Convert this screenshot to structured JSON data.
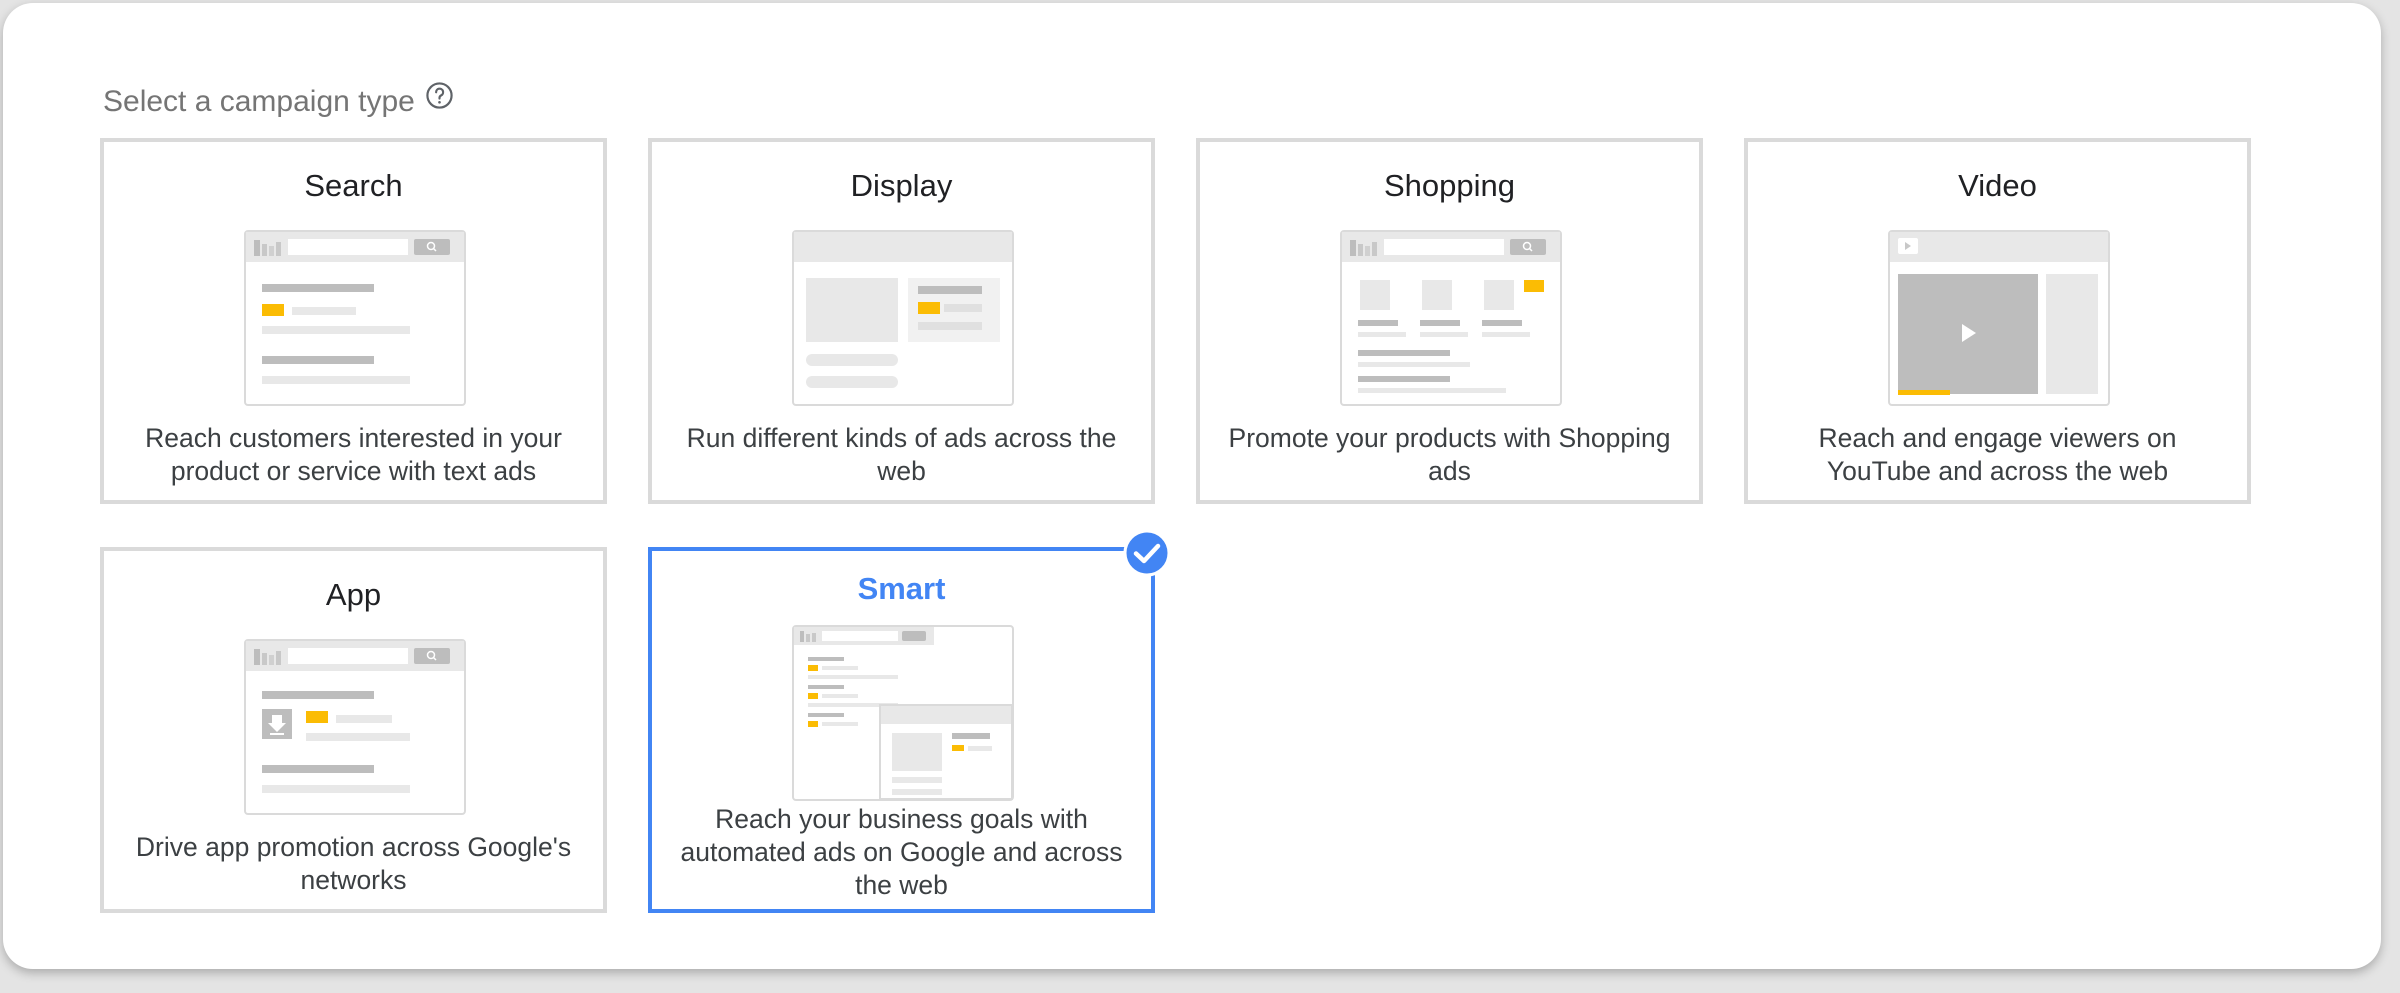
{
  "heading": {
    "label": "Select a campaign type",
    "help_icon": "help-circle-icon"
  },
  "colors": {
    "accent": "#4285f4",
    "border": "#dadada",
    "highlight": "#fbbc04",
    "placeholder": "#e8e8e8"
  },
  "cards": [
    {
      "id": "search",
      "title": "Search",
      "description": "Reach customers interested in your product or service with text ads",
      "selected": false
    },
    {
      "id": "display",
      "title": "Display",
      "description": "Run different kinds of ads across the web",
      "selected": false
    },
    {
      "id": "shopping",
      "title": "Shopping",
      "description": "Promote your products with Shopping ads",
      "selected": false
    },
    {
      "id": "video",
      "title": "Video",
      "description": "Reach and engage viewers on YouTube and across the web",
      "selected": false
    },
    {
      "id": "app",
      "title": "App",
      "description": "Drive app promotion across Google's networks",
      "selected": false
    },
    {
      "id": "smart",
      "title": "Smart",
      "description": "Reach your business goals with automated ads on Google and across the web",
      "selected": true
    }
  ]
}
